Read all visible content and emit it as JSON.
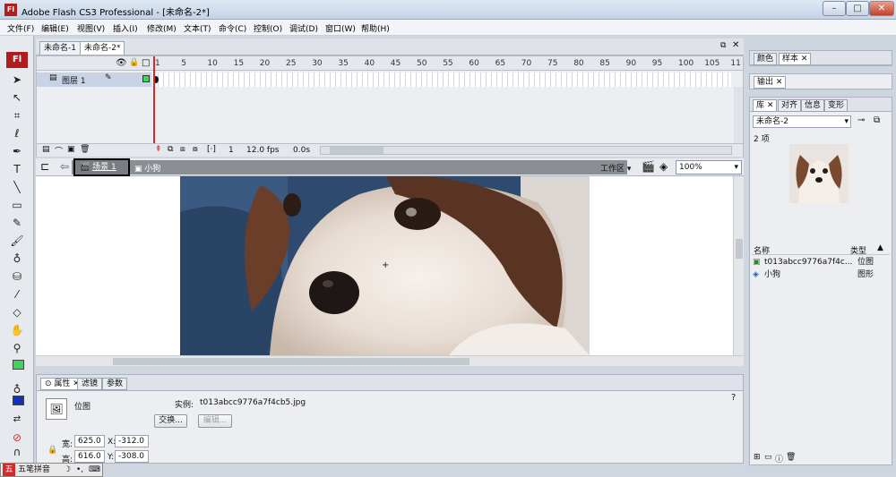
{
  "app": {
    "title": "Adobe Flash CS3 Professional - [未命名-2*]",
    "logo": "Fl",
    "window_buttons": [
      "minimize-icon",
      "maximize-icon",
      "close-icon"
    ]
  },
  "menu": [
    "文件(F)",
    "编辑(E)",
    "视图(V)",
    "插入(I)",
    "修改(M)",
    "文本(T)",
    "命令(C)",
    "控制(O)",
    "调试(D)",
    "窗口(W)",
    "帮助(H)"
  ],
  "documents": {
    "tabs": [
      "未命名-1",
      "未命名-2*"
    ],
    "active": 1
  },
  "timeline": {
    "frame_labels": [
      "1",
      "5",
      "10",
      "15",
      "20",
      "25",
      "30",
      "35",
      "40",
      "45",
      "50",
      "55",
      "60",
      "65",
      "70",
      "75",
      "80",
      "85",
      "90",
      "95",
      "100",
      "105",
      "11"
    ],
    "layer_name": "图层 1",
    "current_frame": "1",
    "fps": "12.0 fps",
    "time": "0.0s"
  },
  "editbar": {
    "scene": "场景 1",
    "symbol": "小狗",
    "workspace": "工作区",
    "zoom": "100%"
  },
  "properties": {
    "tabs": [
      "属性",
      "滤镜",
      "参数"
    ],
    "type": "位图",
    "instance_label": "实例:",
    "instance_value": "t013abcc9776a7f4cb5.jpg",
    "swap_button": "交换...",
    "edit_button": "编辑...",
    "width_label": "宽:",
    "width": "625.0",
    "height_label": "高:",
    "height": "616.0",
    "x_label": "X:",
    "x": "-312.0",
    "y_label": "Y:",
    "y": "-308.0"
  },
  "panels": {
    "color_tabs": [
      "颜色",
      "样本"
    ],
    "output_tab": "输出",
    "library_tabs": [
      "库",
      "对齐",
      "信息",
      "变形"
    ],
    "library_doc": "未命名-2",
    "item_count": "2 项",
    "columns": [
      "名称",
      "类型"
    ],
    "items": [
      {
        "name": "t013abcc9776a7f4c...",
        "type": "位图",
        "icon": "bitmap-icon"
      },
      {
        "name": "小狗",
        "type": "图形",
        "icon": "graphic-symbol-icon"
      }
    ]
  },
  "ime": {
    "label": "五笔拼音"
  },
  "colors": {
    "accent": "#b01d1d",
    "layer_highlight": "#c9d3e6",
    "playhead": "#d42a2a"
  }
}
